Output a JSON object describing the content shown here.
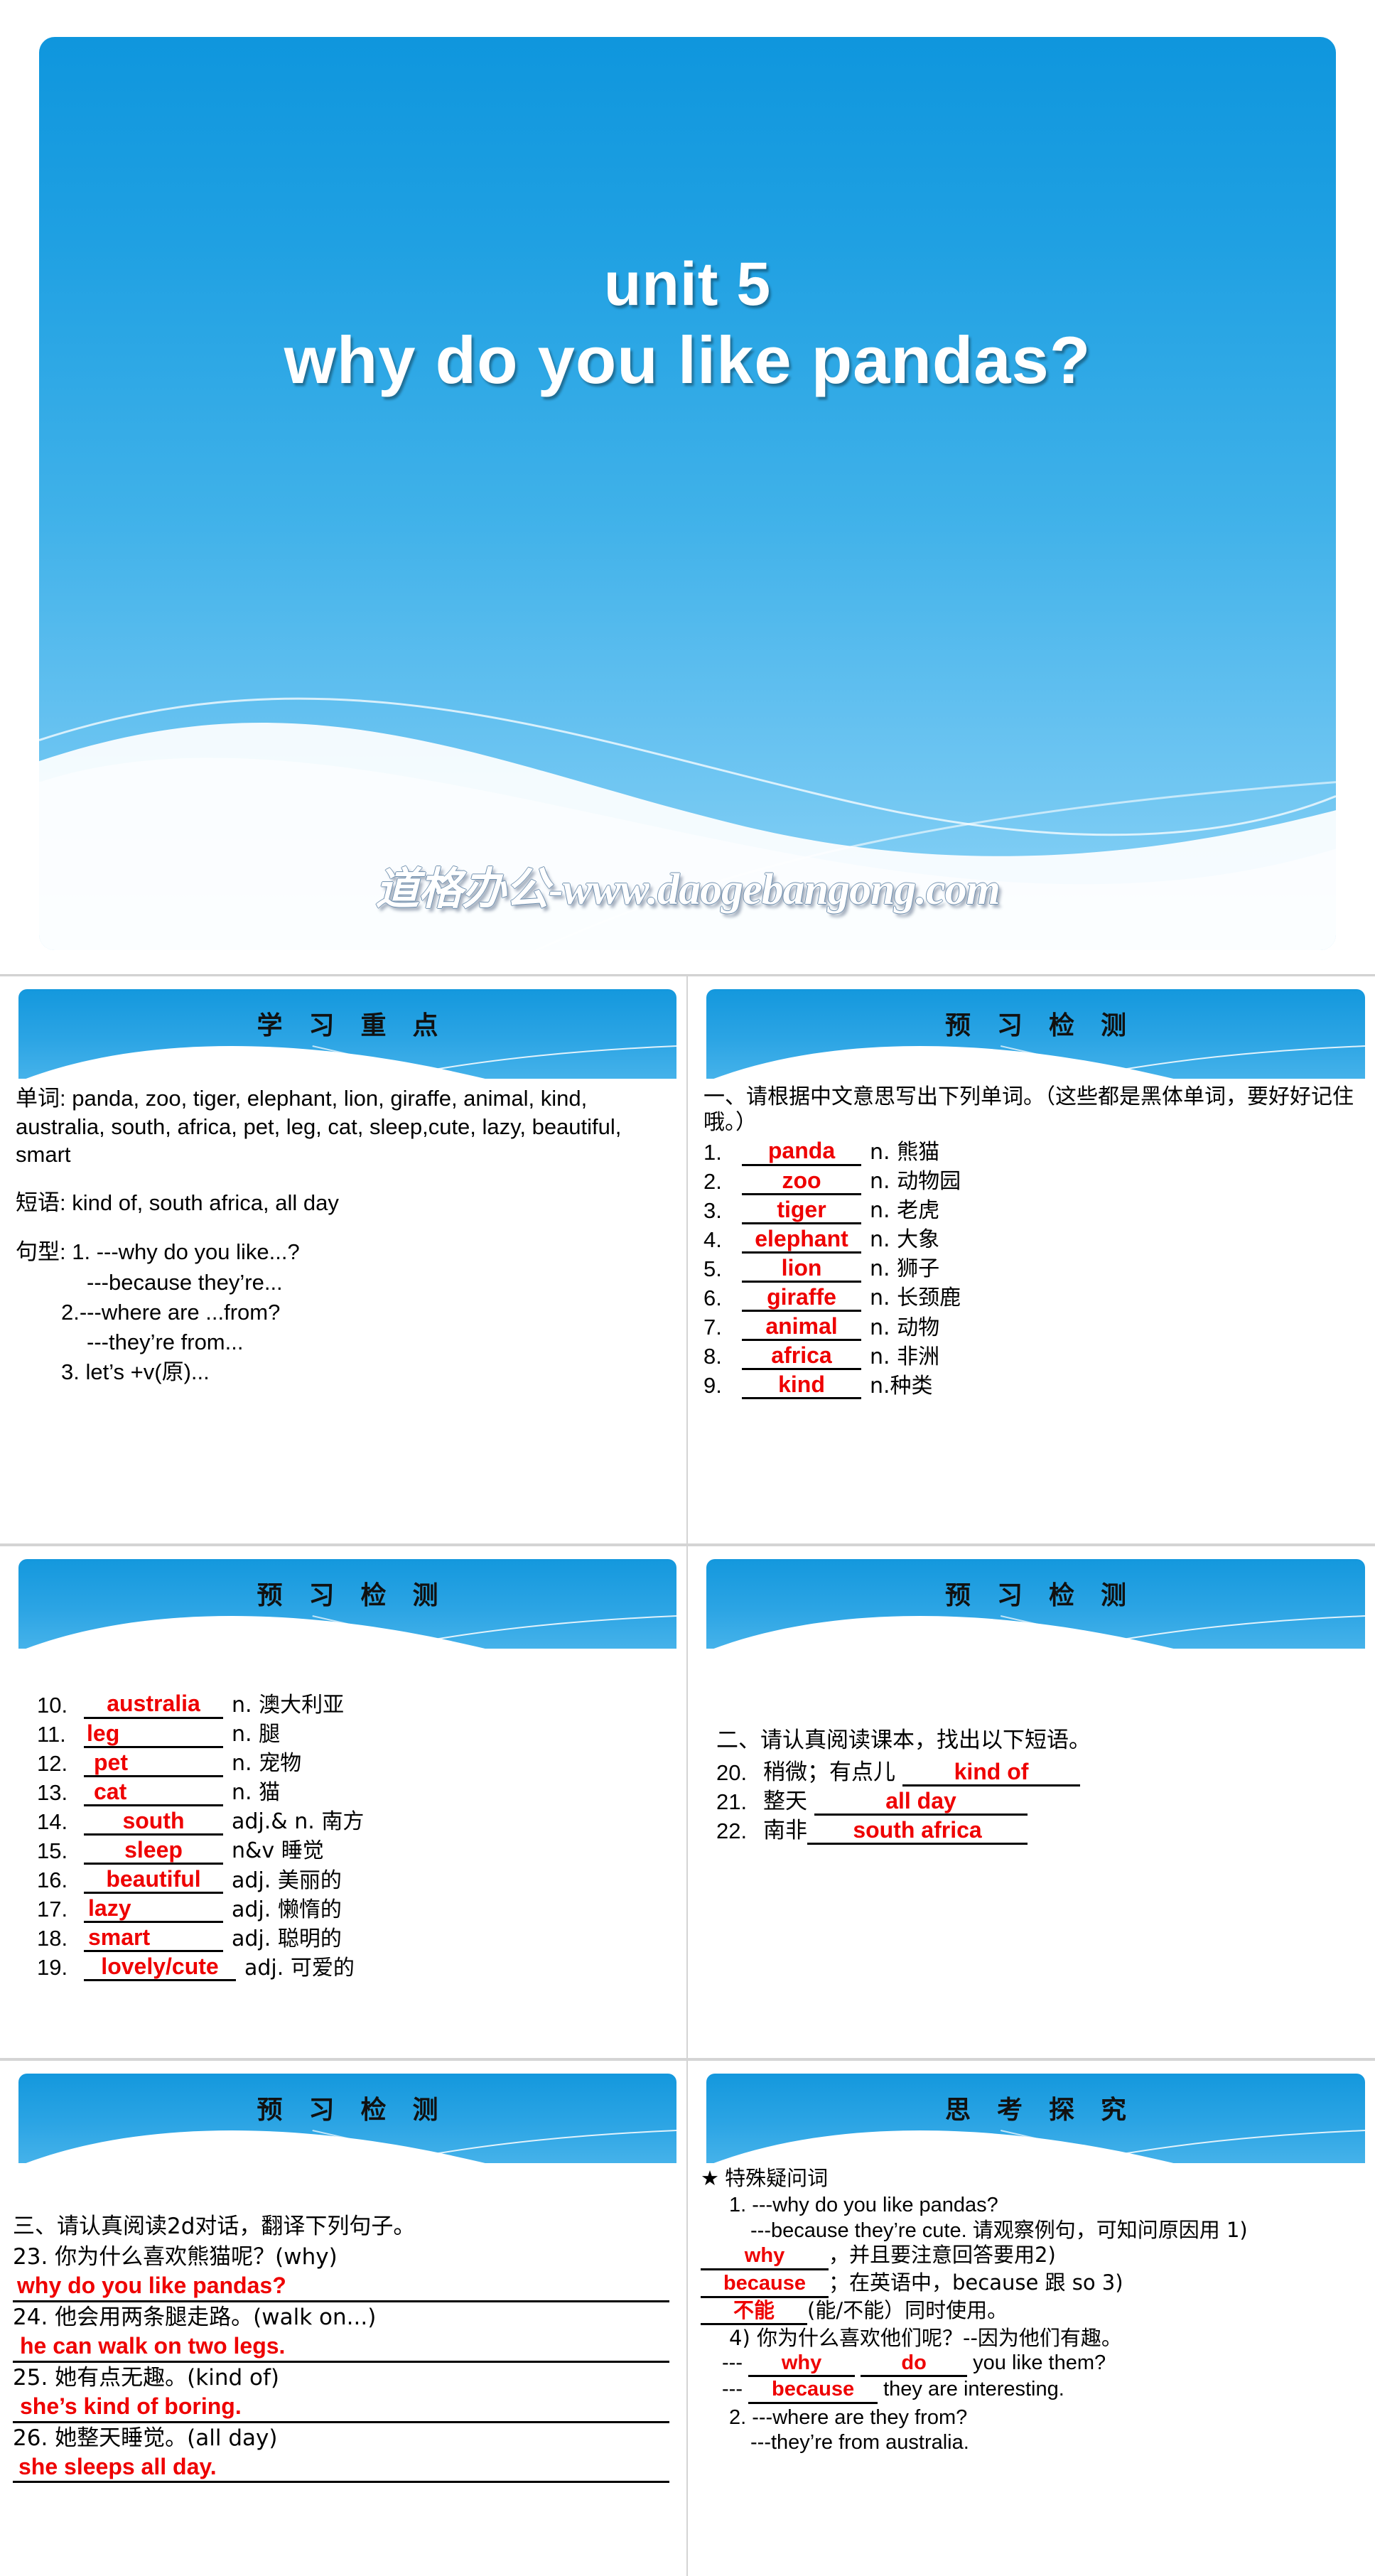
{
  "title_slide": {
    "line1": "unit 5",
    "line2": "why do you like pandas?",
    "watermark": "道格办公-www.daogebangong.com"
  },
  "slides": [
    {
      "header": "学 习 重 点",
      "words_label": "单词",
      "words": "panda, zoo, tiger, elephant, lion, giraffe, animal, kind, australia, south, africa, pet, leg, cat, sleep,cute, lazy, beautiful, smart",
      "phrases_label": "短语",
      "phrases": "kind of, south africa, all day",
      "patterns_label": "句型",
      "patterns": [
        "1. ---why do you like...?",
        "---because they’re...",
        "2.---where are ...from?",
        "---they’re from...",
        "3. let’s +v(原)..."
      ]
    },
    {
      "header": "预 习 检 测",
      "instruction": "一、请根据中文意思写出下列单词。（这些都是黑体单词，要好好记住哦。）",
      "items": [
        {
          "num": "1.",
          "answer": "panda",
          "def": "n. 熊猫"
        },
        {
          "num": "2.",
          "answer": "zoo",
          "def": "n. 动物园"
        },
        {
          "num": "3.",
          "answer": "tiger",
          "def": "n. 老虎"
        },
        {
          "num": "4.",
          "answer": "elephant",
          "def": "n. 大象"
        },
        {
          "num": "5.",
          "answer": "lion",
          "def": "n. 狮子"
        },
        {
          "num": "6.",
          "answer": "giraffe",
          "def": "n. 长颈鹿"
        },
        {
          "num": "7.",
          "answer": "animal",
          "def": "n. 动物"
        },
        {
          "num": "8.",
          "answer": "africa",
          "def": "n. 非洲"
        },
        {
          "num": "9.",
          "answer": "kind",
          "def": "n.种类"
        }
      ]
    },
    {
      "header": "预 习 检 测",
      "items": [
        {
          "num": "10.",
          "answer": "australia",
          "def": "n. 澳大利亚"
        },
        {
          "num": "11.",
          "answer": "leg",
          "def": "n. 腿"
        },
        {
          "num": "12.",
          "answer": "pet",
          "def": "n. 宠物"
        },
        {
          "num": "13.",
          "answer": "cat",
          "def": "n. 猫"
        },
        {
          "num": "14.",
          "answer": "south",
          "def": "adj.& n. 南方"
        },
        {
          "num": "15.",
          "answer": "sleep",
          "def": "n&v 睡觉"
        },
        {
          "num": "16.",
          "answer": "beautiful",
          "def": "adj. 美丽的"
        },
        {
          "num": "17.",
          "answer": "lazy",
          "def": "adj. 懒惰的"
        },
        {
          "num": "18.",
          "answer": "smart",
          "def": "adj. 聪明的"
        },
        {
          "num": "19.",
          "answer": "lovely/cute",
          "def": "adj. 可爱的"
        }
      ]
    },
    {
      "header": "预 习 检 测",
      "instruction": "二、请认真阅读课本，找出以下短语。",
      "items": [
        {
          "num": "20.",
          "cn": "稍微；有点儿",
          "answer": "kind of"
        },
        {
          "num": "21.",
          "cn": "整天",
          "answer": "all day"
        },
        {
          "num": "22.",
          "cn": "南非",
          "answer": "south africa"
        }
      ]
    },
    {
      "header": "预 习 检 测",
      "instruction": "三、请认真阅读2d对话，翻译下列句子。",
      "items": [
        {
          "num": "23.",
          "cn": "你为什么喜欢熊猫呢？(why)",
          "answer": "why do you like pandas?"
        },
        {
          "num": "24.",
          "cn": "他会用两条腿走路。(walk on...)",
          "answer": "he can walk on two legs."
        },
        {
          "num": "25.",
          "cn": "她有点无趣。(kind of)",
          "answer": "she’s kind of boring."
        },
        {
          "num": "26.",
          "cn": "她整天睡觉。(all day)",
          "answer": "she sleeps all day."
        }
      ]
    },
    {
      "header": "思 考 探 究",
      "star_heading": "特殊疑问词",
      "q1": "1. ---why do you like pandas?",
      "q1a": "---because they’re cute.",
      "expl_a": "请观察例句，可知问原因用 1)",
      "blank1": "why",
      "expl_b": "，并且要注意回答要用2)",
      "blank2": "because",
      "expl_c": "；在英语中，because 跟 so 3)",
      "blank3": "不能",
      "expl_d": "(能/不能）同时使用。",
      "q4": "4) 你为什么喜欢他们呢？--因为他们有趣。",
      "q4_dash": "---",
      "q4_blank1": "why",
      "q4_blank2": "do",
      "q4_tail": "you like them?",
      "a4_dash": "---",
      "a4_blank": "because",
      "a4_tail": "they are interesting.",
      "q2": "2. ---where are they from?",
      "q2a": "---they’re from australia."
    }
  ]
}
